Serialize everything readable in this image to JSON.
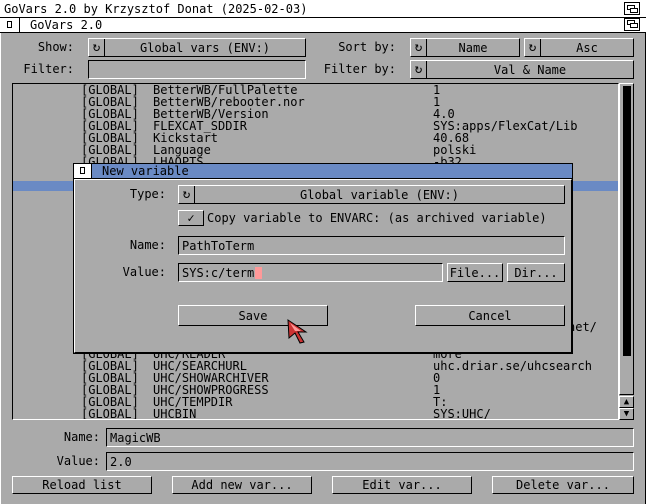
{
  "screen": {
    "title": "GoVars 2.0 by Krzysztof Donat (2025-02-03)"
  },
  "window": {
    "title": "GoVars 2.0"
  },
  "filters": {
    "show_label": "Show:",
    "show_value": "Global vars (ENV:)",
    "sort_label": "Sort by:",
    "sort_field": "Name",
    "sort_order": "Asc",
    "filter_label": "Filter:",
    "filter_value": "",
    "filter_by_label": "Filter by:",
    "filter_by_value": "Val & Name"
  },
  "list": {
    "rows_top": [
      {
        "scope": "[GLOBAL]",
        "name": "BetterWB/FullPalette",
        "value": "1"
      },
      {
        "scope": "[GLOBAL]",
        "name": "BetterWB/rebooter.nor",
        "value": "1"
      },
      {
        "scope": "[GLOBAL]",
        "name": "BetterWB/Version",
        "value": "4.0"
      },
      {
        "scope": "[GLOBAL]",
        "name": "FLEXCAT_SDDIR",
        "value": "SYS:apps/FlexCat/Lib"
      },
      {
        "scope": "[GLOBAL]",
        "name": "Kickstart",
        "value": "40.68"
      },
      {
        "scope": "[GLOBAL]",
        "name": "Language",
        "value": "polski"
      },
      {
        "scope": "[GLOBAL]",
        "name": "LHAOPTS",
        "value": "-b32"
      }
    ],
    "partial_value": "het/",
    "rows_bottom": [
      {
        "scope": "[GLOBAL]",
        "name": "UHC/READER",
        "value": "more"
      },
      {
        "scope": "[GLOBAL]",
        "name": "UHC/SEARCHURL",
        "value": "uhc.driar.se/uhcsearch"
      },
      {
        "scope": "[GLOBAL]",
        "name": "UHC/SHOWARCHIVER",
        "value": "0"
      },
      {
        "scope": "[GLOBAL]",
        "name": "UHC/SHOWPROGRESS",
        "value": "1"
      },
      {
        "scope": "[GLOBAL]",
        "name": "UHC/TEMPDIR",
        "value": "T:"
      },
      {
        "scope": "[GLOBAL]",
        "name": "UHCBIN",
        "value": "SYS:UHC/"
      }
    ]
  },
  "details": {
    "name_label": "Name:",
    "name_value": "MagicWB",
    "value_label": "Value:",
    "value_value": "2.0"
  },
  "buttons": {
    "reload": "Reload list",
    "add": "Add new var...",
    "edit": "Edit var...",
    "delete": "Delete var..."
  },
  "dialog": {
    "title": "New variable",
    "type_label": "Type:",
    "type_value": "Global variable (ENV:)",
    "copy_label": "Copy variable to ENVARC: (as archived variable)",
    "copy_checked": true,
    "name_label": "Name:",
    "name_value": "PathToTerm",
    "value_label": "Value:",
    "value_value": "SYS:c/term",
    "file_button": "File...",
    "dir_button": "Dir...",
    "save_button": "Save",
    "cancel_button": "Cancel"
  },
  "colors": {
    "background": "#aaaaaa",
    "selection": "#6a8ac4",
    "cursor": "#ff9999"
  }
}
